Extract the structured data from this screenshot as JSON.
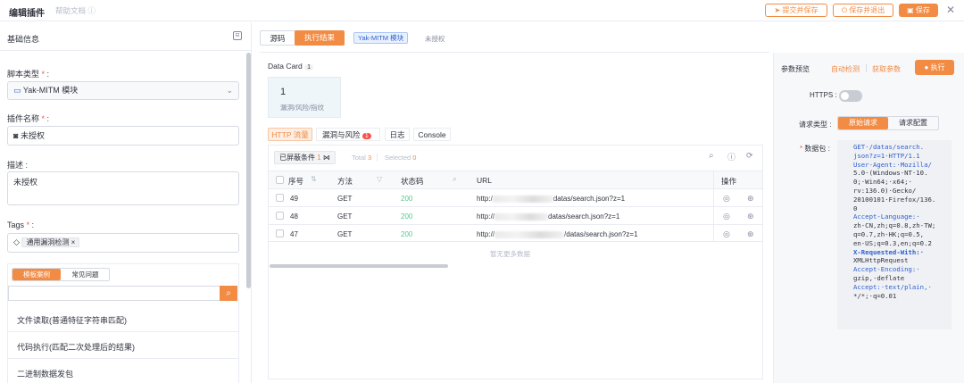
{
  "header": {
    "title": "编辑插件",
    "help": "帮助文档",
    "submit_label": "提交并保存",
    "save_exit_label": "保存并退出",
    "save_label": "保存"
  },
  "left": {
    "section_title": "基础信息",
    "script_type_label": "脚本类型",
    "script_type_value": "Yak-MITM 模块",
    "name_label": "插件名称",
    "name_value": "未授权",
    "desc_label": "描述",
    "desc_value": "未授权",
    "tags_label": "Tags",
    "tag_value": "通用漏洞检测",
    "subtabs": [
      "模板案例",
      "常见问题"
    ],
    "list": [
      "文件读取(普通特征字符串匹配)",
      "代码执行(匹配二次处理后的结果)",
      "二进制数据发包"
    ]
  },
  "center": {
    "tabs": [
      "源码",
      "执行结果"
    ],
    "badge": "Yak-MITM 模块",
    "plugin_name": "未授权",
    "data_card_label": "Data Card",
    "data_card_count": "1",
    "card_value": "1",
    "card_caption": "漏洞/风险/指纹",
    "result_tabs": [
      {
        "label": "HTTP 流量"
      },
      {
        "label": "漏洞与风险",
        "badge": "1"
      },
      {
        "label": "日志"
      },
      {
        "label": "Console"
      }
    ],
    "filter_label": "已屏蔽条件",
    "filter_count": "1",
    "total_label": "Total",
    "total_value": "3",
    "selected_label": "Selected",
    "selected_value": "0",
    "columns": [
      "序号",
      "方法",
      "状态码",
      "URL",
      "操作"
    ],
    "rows": [
      {
        "id": "49",
        "method": "GET",
        "status": "200",
        "url_prefix": "http:/",
        "url_suffix": "datas/search.json?z=1"
      },
      {
        "id": "48",
        "method": "GET",
        "status": "200",
        "url_prefix": "http://",
        "url_suffix": "datas/search.json?z=1"
      },
      {
        "id": "47",
        "method": "GET",
        "status": "200",
        "url_prefix": "http://",
        "url_suffix": "/datas/search.json?z=1"
      }
    ],
    "no_more": "暂无更多数据"
  },
  "right": {
    "title": "参数预览",
    "auto_detect": "自动检测",
    "get_params": "获取参数",
    "execute": "执行",
    "https_label": "HTTPS",
    "req_type_label": "请求类型",
    "req_tabs": [
      "原始请求",
      "请求配置"
    ],
    "packet_label": "数据包",
    "code_lines": [
      "GET·/datas/search.",
      "json?z=1·HTTP/1.1",
      "User-Agent:·Mozilla/",
      "5.0·(Windows·NT·10.",
      "0;·Win64;·x64;·",
      "rv:136.0)·Gecko/",
      "20100101·Firefox/136.",
      "0",
      "Accept-Language:·",
      "zh-CN,zh;q=0.8,zh-TW;",
      "q=0.7,zh-HK;q=0.5,",
      "en-US;q=0.3,en;q=0.2",
      "X-Requested-With:·",
      "XMLHttpRequest",
      "Accept-Encoding:·",
      "gzip,·deflate",
      "Accept:·text/plain,·",
      "*/*;·q=0.01"
    ]
  },
  "colors": {
    "accent": "#f28b44",
    "blue": "#2b5fcf",
    "green": "#56c991",
    "danger": "#f5544d"
  }
}
